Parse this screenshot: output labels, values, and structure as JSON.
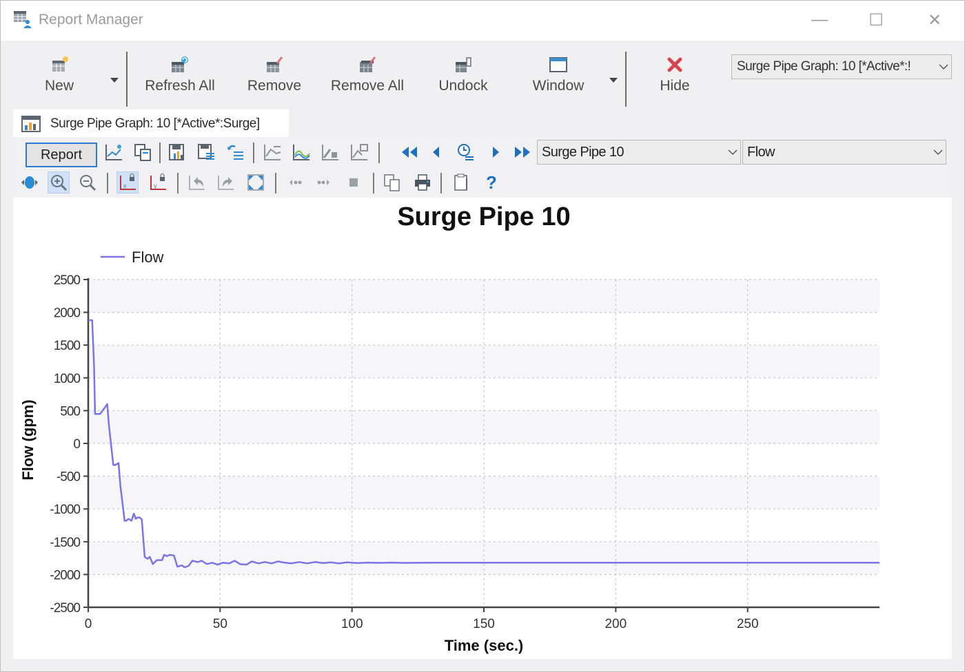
{
  "window": {
    "title": "Report Manager",
    "controls": {
      "minimize": "—",
      "maximize": "☐",
      "close": "✕"
    }
  },
  "ribbon": {
    "buttons": [
      {
        "label": "New",
        "icon": "new-report-icon"
      },
      {
        "label": "Refresh All",
        "icon": "refresh-all-icon"
      },
      {
        "label": "Remove",
        "icon": "remove-icon"
      },
      {
        "label": "Remove All",
        "icon": "remove-all-icon"
      },
      {
        "label": "Undock",
        "icon": "undock-icon"
      },
      {
        "label": "Window",
        "icon": "window-icon"
      },
      {
        "label": "Hide",
        "icon": "hide-icon"
      }
    ],
    "active_report_select": "Surge Pipe Graph: 10 [*Active*:Surge]",
    "active_report_select_display": "Surge Pipe Graph: 10 [*Active*:!"
  },
  "doc_tab": {
    "label": "Surge Pipe Graph: 10 [*Active*:Surge]"
  },
  "graph_toolbar": {
    "report_label": "Report",
    "element_select": "Surge Pipe 10",
    "field_select": "Flow",
    "help_glyph": "?"
  },
  "colors": {
    "series": "#7b74e6",
    "accent": "#2c7bd6",
    "hide": "#d9434e",
    "nav": "#1e6fc0"
  },
  "chart_data": {
    "type": "line",
    "title": "Surge Pipe 10",
    "xlabel": "Time (sec.)",
    "ylabel": "Flow (gpm)",
    "xlim": [
      0,
      300
    ],
    "ylim": [
      -2500,
      2500
    ],
    "xticks": [
      0,
      50,
      100,
      150,
      200,
      250
    ],
    "yticks": [
      2500,
      2000,
      1500,
      1000,
      500,
      0,
      -500,
      -1000,
      -1500,
      -2000,
      -2500
    ],
    "grid": true,
    "legend": {
      "position": "top-left",
      "entries": [
        "Flow"
      ]
    },
    "series": [
      {
        "name": "Flow",
        "x": [
          0,
          1.5,
          2.2,
          2.6,
          4.5,
          6.5,
          7.2,
          7.8,
          9.5,
          10.2,
          11.5,
          12.2,
          13.8,
          14.4,
          15.3,
          16.4,
          17.3,
          18.0,
          18.6,
          19.5,
          20.3,
          21.4,
          22.5,
          23.3,
          24.5,
          26.0,
          28.0,
          28.8,
          29.8,
          31.0,
          32.5,
          33.8,
          35.5,
          36.5,
          38.0,
          39.5,
          41.5,
          43.0,
          45.0,
          47.0,
          49.0,
          51.0,
          53.5,
          55.5,
          57.5,
          60.0,
          62.0,
          64.5,
          67.0,
          69.5,
          72.0,
          74.5,
          77.0,
          80.0,
          83.0,
          86.0,
          89.0,
          92.0,
          95.0,
          98.0,
          102.0,
          106.0,
          110.0,
          115.0,
          120.0,
          130.0,
          140.0,
          160.0,
          200.0,
          250.0,
          300.0
        ],
        "y": [
          1880,
          1880,
          1200,
          450,
          450,
          560,
          600,
          300,
          -330,
          -330,
          -300,
          -650,
          -1180,
          -1180,
          -1150,
          -1180,
          -1070,
          -1150,
          -1130,
          -1130,
          -1160,
          -1730,
          -1760,
          -1730,
          -1840,
          -1780,
          -1780,
          -1700,
          -1720,
          -1700,
          -1710,
          -1880,
          -1860,
          -1890,
          -1870,
          -1790,
          -1810,
          -1790,
          -1840,
          -1820,
          -1850,
          -1820,
          -1830,
          -1790,
          -1840,
          -1850,
          -1800,
          -1830,
          -1810,
          -1830,
          -1800,
          -1820,
          -1830,
          -1810,
          -1830,
          -1810,
          -1825,
          -1815,
          -1830,
          -1815,
          -1825,
          -1818,
          -1822,
          -1818,
          -1822,
          -1820,
          -1820,
          -1820,
          -1820,
          -1820,
          -1820
        ]
      }
    ]
  }
}
